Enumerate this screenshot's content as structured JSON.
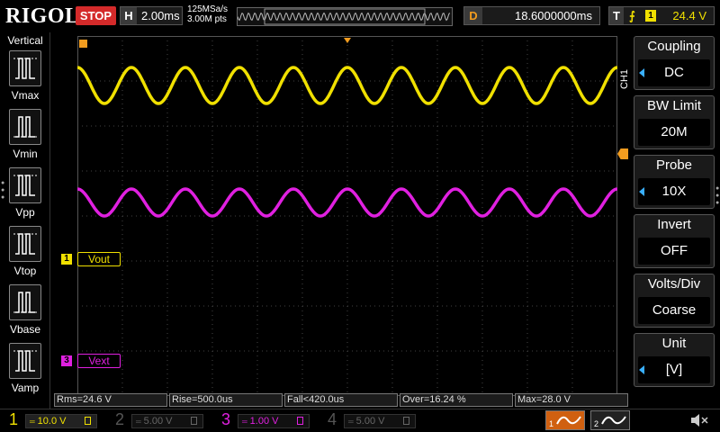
{
  "brand": "RIGOL",
  "run_state": "STOP",
  "horizontal": {
    "label": "H",
    "timebase": "2.00ms"
  },
  "acquisition": {
    "sample_rate": "125MSa/s",
    "points": "3.00M pts"
  },
  "delay": {
    "label": "D",
    "value": "18.6000000ms"
  },
  "trigger": {
    "label": "T",
    "edge": "⨍",
    "source": "1",
    "level": "24.4 V"
  },
  "left_panel": {
    "title": "Vertical",
    "measurements": [
      {
        "label": "Vmax",
        "icon": "vmax-icon"
      },
      {
        "label": "Vmin",
        "icon": "vmin-icon"
      },
      {
        "label": "Vpp",
        "icon": "vpp-icon"
      },
      {
        "label": "Vtop",
        "icon": "vtop-icon"
      },
      {
        "label": "Vbase",
        "icon": "vbase-icon"
      },
      {
        "label": "Vamp",
        "icon": "vamp-icon"
      }
    ]
  },
  "channel_tag": "CH1",
  "menu": [
    {
      "title": "Coupling",
      "value": "DC",
      "arrow": true
    },
    {
      "title": "BW Limit",
      "value": "20M",
      "arrow": false
    },
    {
      "title": "Probe",
      "value": "10X",
      "arrow": true
    },
    {
      "title": "Invert",
      "value": "OFF",
      "arrow": false
    },
    {
      "title": "Volts/Div",
      "value": "Coarse",
      "arrow": false
    },
    {
      "title": "Unit",
      "value": "[V]",
      "arrow": true
    }
  ],
  "traces": [
    {
      "channel": "1",
      "label": "Vout",
      "color": "#f0e000",
      "cycles": 10,
      "amplitude_div": 0.4,
      "center_div": 1.1
    },
    {
      "channel": "3",
      "label": "Vext",
      "color": "#e020e0",
      "cycles": 10,
      "amplitude_div": 0.3,
      "center_div": 3.7
    }
  ],
  "results": [
    "Rms=24.6 V",
    "Rise=500.0us",
    "Fall<420.0us",
    "Over=16.24 %",
    "Max=28.0 V"
  ],
  "channels": [
    {
      "num": "1",
      "scale": "10.0 V",
      "color": "#f0e000",
      "active": true
    },
    {
      "num": "2",
      "scale": "5.00 V",
      "color": "#1a8c8c",
      "active": false
    },
    {
      "num": "3",
      "scale": "1.00 V",
      "color": "#e020e0",
      "active": true
    },
    {
      "num": "4",
      "scale": "5.00 V",
      "color": "#3377dd",
      "active": false
    }
  ],
  "func_buttons": [
    "1",
    "2"
  ],
  "colors": {
    "ch1": "#f0e000",
    "ch3": "#e020e0",
    "stop": "#d42a2a",
    "delay": "#f29c1f",
    "menu_arrow": "#3ab0ff",
    "grid": "#444444"
  }
}
